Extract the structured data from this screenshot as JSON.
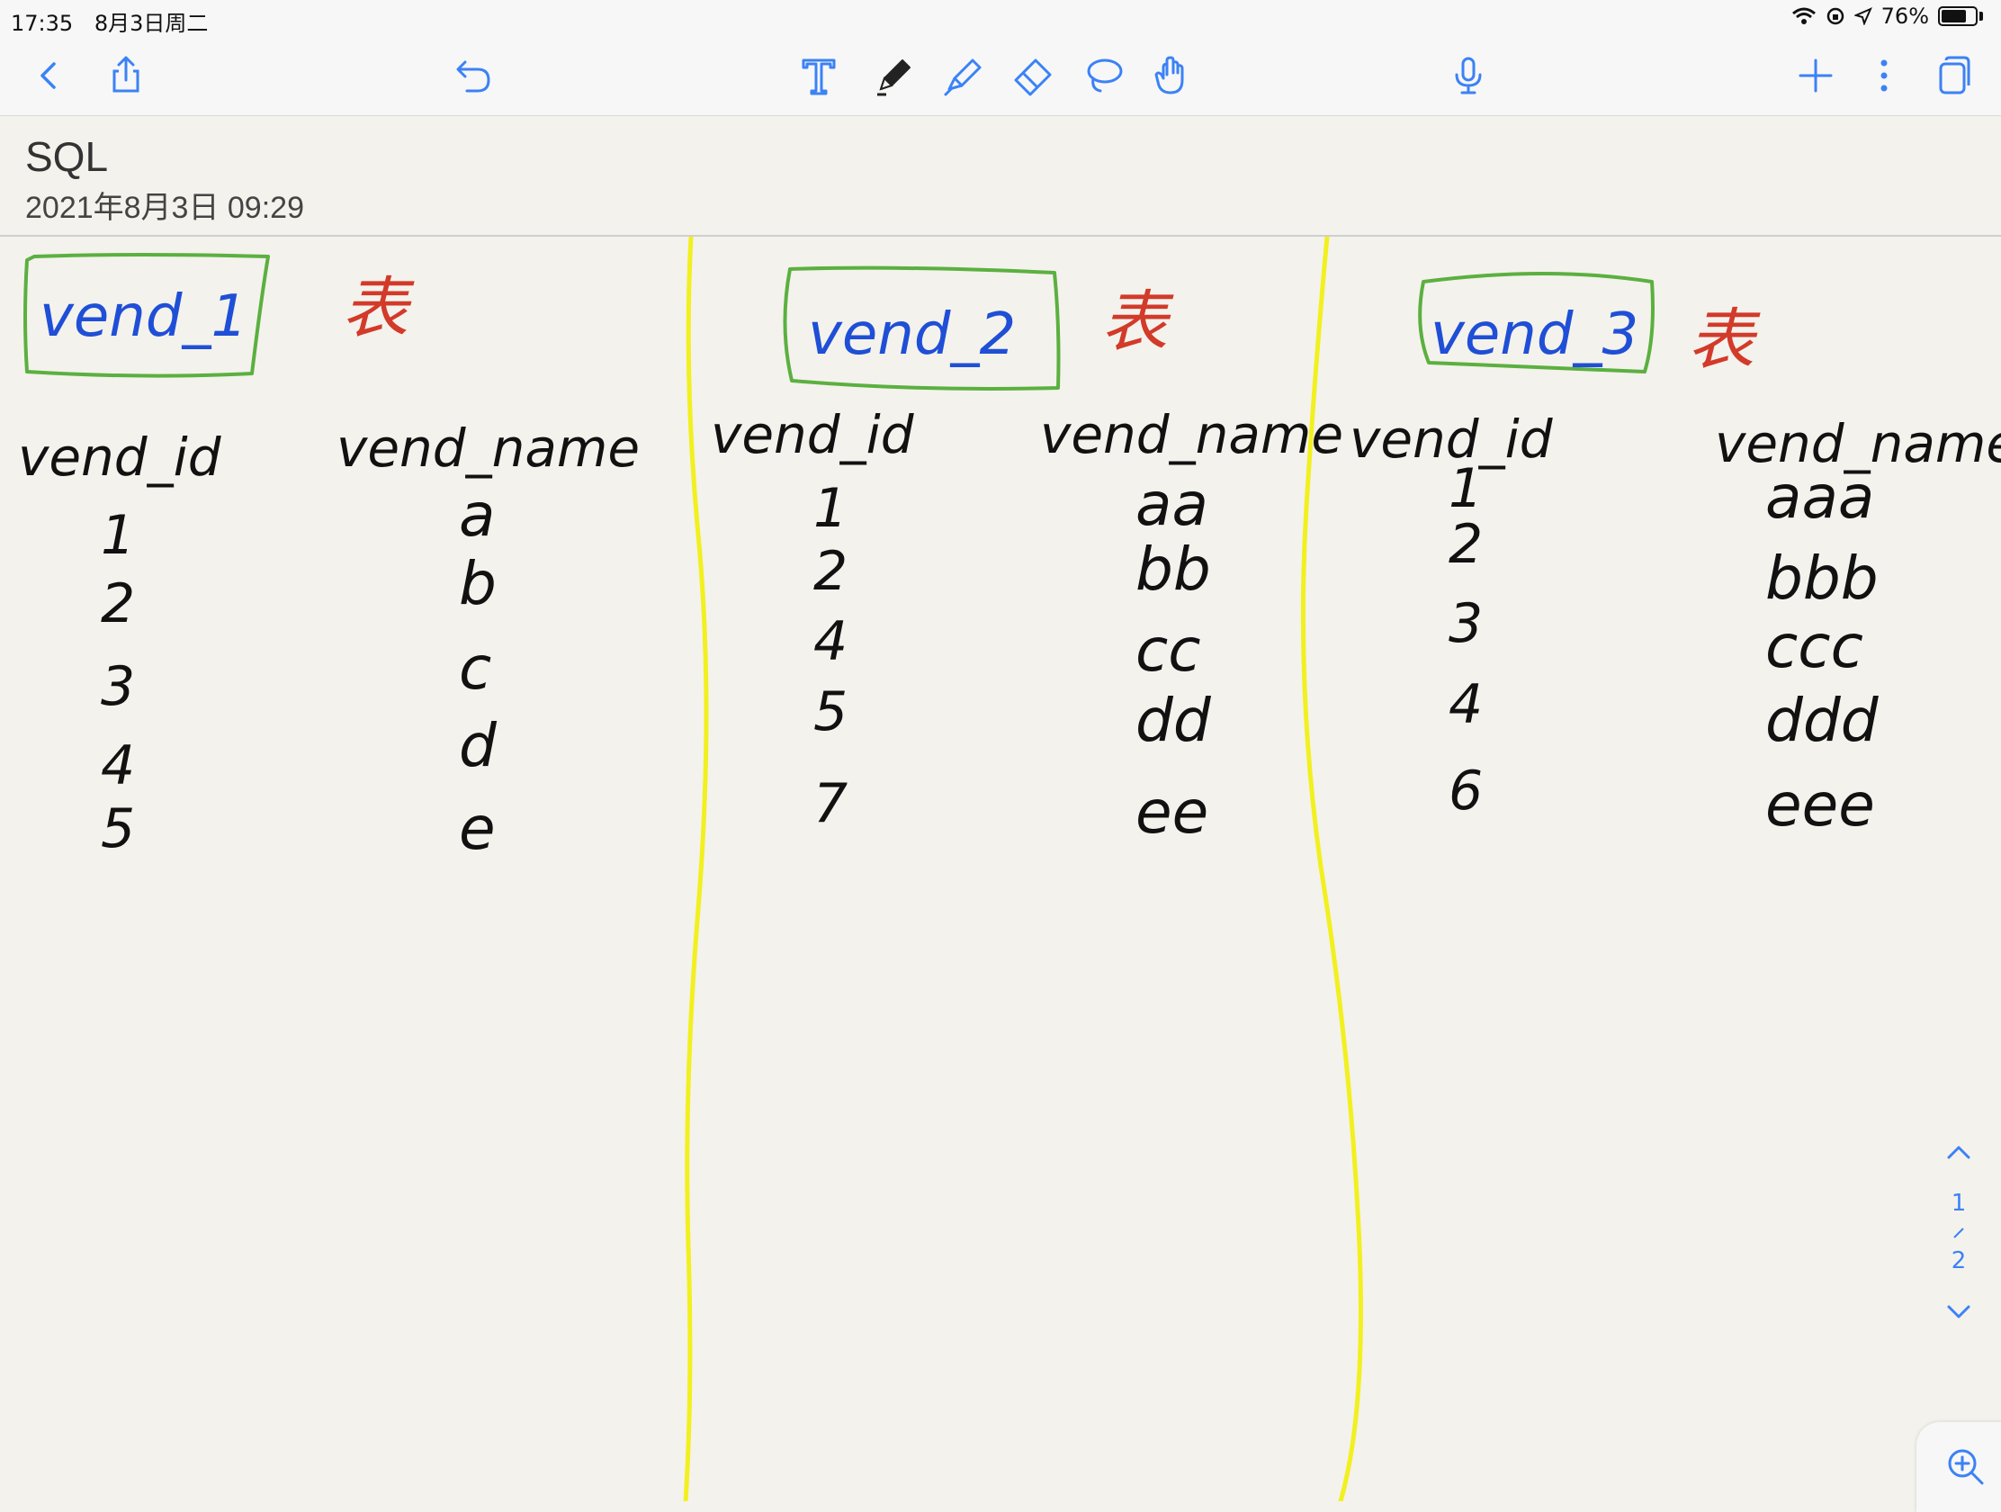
{
  "status": {
    "time": "17:35",
    "date": "8月3日周二",
    "battery_percent": "76%",
    "battery_level": 0.76
  },
  "toolbar": {
    "icons": [
      "back-icon",
      "share-icon",
      "undo-icon",
      "text-tool-icon",
      "pen-tool-icon",
      "highlighter-tool-icon",
      "eraser-tool-icon",
      "lasso-tool-icon",
      "hand-tool-icon",
      "microphone-icon",
      "add-page-icon",
      "more-icon",
      "pages-overview-icon"
    ],
    "accent_color": "#3b82f6"
  },
  "note": {
    "title": "SQL",
    "date": "2021年8月3日 09:29"
  },
  "tables": [
    {
      "name": "vend_1",
      "suffix": "表",
      "headers": [
        "vend_id",
        "vend_name"
      ],
      "rows": [
        [
          "1",
          "a"
        ],
        [
          "2",
          "b"
        ],
        [
          "3",
          "c"
        ],
        [
          "4",
          "d"
        ],
        [
          "5",
          "e"
        ]
      ]
    },
    {
      "name": "vend_2",
      "suffix": "表",
      "headers": [
        "vend_id",
        "vend_name"
      ],
      "rows": [
        [
          "1",
          "aa"
        ],
        [
          "2",
          "bb"
        ],
        [
          "4",
          "cc"
        ],
        [
          "5",
          "dd"
        ],
        [
          "7",
          "ee"
        ]
      ]
    },
    {
      "name": "vend_3",
      "suffix": "表",
      "headers": [
        "vend_id",
        "vend_name"
      ],
      "rows": [
        [
          "1",
          "aaa"
        ],
        [
          "2",
          "bbb"
        ],
        [
          "3",
          "ccc"
        ],
        [
          "4",
          "ddd"
        ],
        [
          "6",
          "eee"
        ]
      ]
    }
  ],
  "ink_colors": {
    "table_name": "#1f4fd6",
    "box": "#5bb040",
    "suffix": "#d23a2a",
    "text": "#111111",
    "divider": "#f2f01e"
  },
  "pager": {
    "current": "1",
    "total": "2"
  }
}
